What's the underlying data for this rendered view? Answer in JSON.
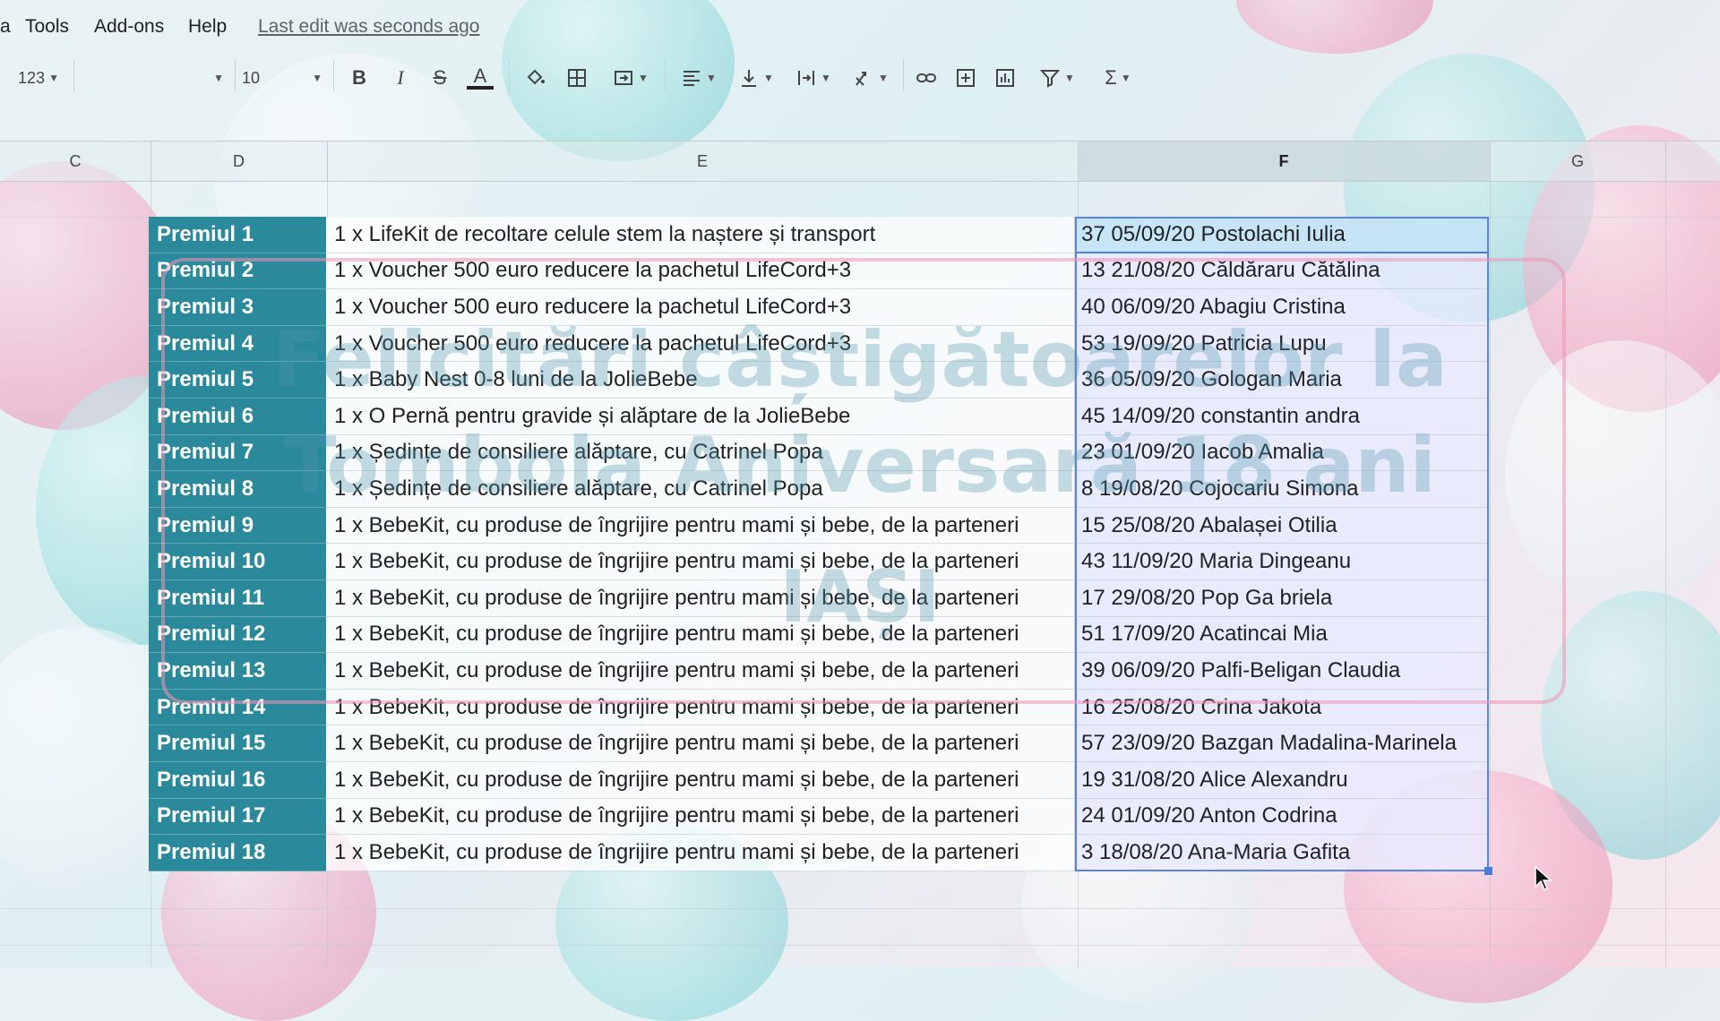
{
  "menu": {
    "partial_item": "a",
    "items": [
      "Tools",
      "Add-ons",
      "Help"
    ],
    "last_edit": "Last edit was seconds ago"
  },
  "toolbar": {
    "format_label": "123",
    "font_size": "10"
  },
  "columns": [
    "C",
    "D",
    "E",
    "F",
    "G"
  ],
  "selected_column": "F",
  "overlay": {
    "line1": "Felicitări câștigătoarelor la",
    "line2": "Tombola Aniversară 18 ani",
    "line3": "IAȘI"
  },
  "prizes": [
    {
      "prize": "Premiul 1",
      "description": "1 x LifeKit de recoltare celule stem la naștere și transport",
      "winner": "37 05/09/20 Postolachi Iulia"
    },
    {
      "prize": "Premiul 2",
      "description": "1 x Voucher 500 euro reducere la pachetul LifeCord+3",
      "winner": "13 21/08/20 Căldăraru Cătălina"
    },
    {
      "prize": "Premiul 3",
      "description": "1 x Voucher 500 euro reducere la pachetul LifeCord+3",
      "winner": "40 06/09/20 Abagiu Cristina"
    },
    {
      "prize": "Premiul 4",
      "description": "1 x Voucher 500 euro reducere la pachetul LifeCord+3",
      "winner": "53 19/09/20 Patricia Lupu"
    },
    {
      "prize": "Premiul 5",
      "description": "1 x Baby Nest 0-8 luni de la JolieBebe",
      "winner": "36 05/09/20 Gologan Maria"
    },
    {
      "prize": "Premiul 6",
      "description": "1 x O Pernă pentru gravide și alăptare de la JolieBebe",
      "winner": "45 14/09/20 constantin andra"
    },
    {
      "prize": "Premiul 7",
      "description": "1 x Ședințe de consiliere alăptare, cu Catrinel Popa",
      "winner": "23 01/09/20 Iacob Amalia"
    },
    {
      "prize": "Premiul 8",
      "description": "1 x Ședințe de consiliere alăptare, cu Catrinel Popa",
      "winner": "8 19/08/20 Cojocariu Simona"
    },
    {
      "prize": "Premiul 9",
      "description": "1 x BebeKit, cu produse de îngrijire pentru mami și bebe, de la parteneri",
      "winner": "15 25/08/20 Abalașei Otilia"
    },
    {
      "prize": "Premiul 10",
      "description": "1 x BebeKit, cu produse de îngrijire pentru mami și bebe, de la parteneri",
      "winner": "43 11/09/20 Maria Dingeanu"
    },
    {
      "prize": "Premiul 11",
      "description": "1 x BebeKit, cu produse de îngrijire pentru mami și bebe, de la parteneri",
      "winner": "17 29/08/20 Pop Ga briela"
    },
    {
      "prize": "Premiul 12",
      "description": "1 x BebeKit, cu produse de îngrijire pentru mami și bebe, de la parteneri",
      "winner": "51 17/09/20 Acatincai Mia"
    },
    {
      "prize": "Premiul 13",
      "description": "1 x BebeKit, cu produse de îngrijire pentru mami și bebe, de la parteneri",
      "winner": "39 06/09/20 Palfi-Beligan Claudia"
    },
    {
      "prize": "Premiul 14",
      "description": "1 x BebeKit, cu produse de îngrijire pentru mami și bebe, de la parteneri",
      "winner": "16 25/08/20 Crina Jakota"
    },
    {
      "prize": "Premiul 15",
      "description": "1 x BebeKit, cu produse de îngrijire pentru mami și bebe, de la parteneri",
      "winner": "57 23/09/20 Bazgan Madalina-Marinela"
    },
    {
      "prize": "Premiul 16",
      "description": "1 x BebeKit, cu produse de îngrijire pentru mami și bebe, de la parteneri",
      "winner": "19 31/08/20 Alice Alexandru"
    },
    {
      "prize": "Premiul 17",
      "description": "1 x BebeKit, cu produse de îngrijire pentru mami și bebe, de la parteneri",
      "winner": "24 01/09/20 Anton Codrina"
    },
    {
      "prize": "Premiul 18",
      "description": "1 x BebeKit, cu produse de îngrijire pentru mami și bebe, de la parteneri",
      "winner": "3 18/08/20 Ana-Maria Gafita"
    }
  ],
  "colors": {
    "prize_column": "#2a8a9c",
    "selection": "#4a7fd8",
    "overlay_border": "#ee96b4"
  }
}
